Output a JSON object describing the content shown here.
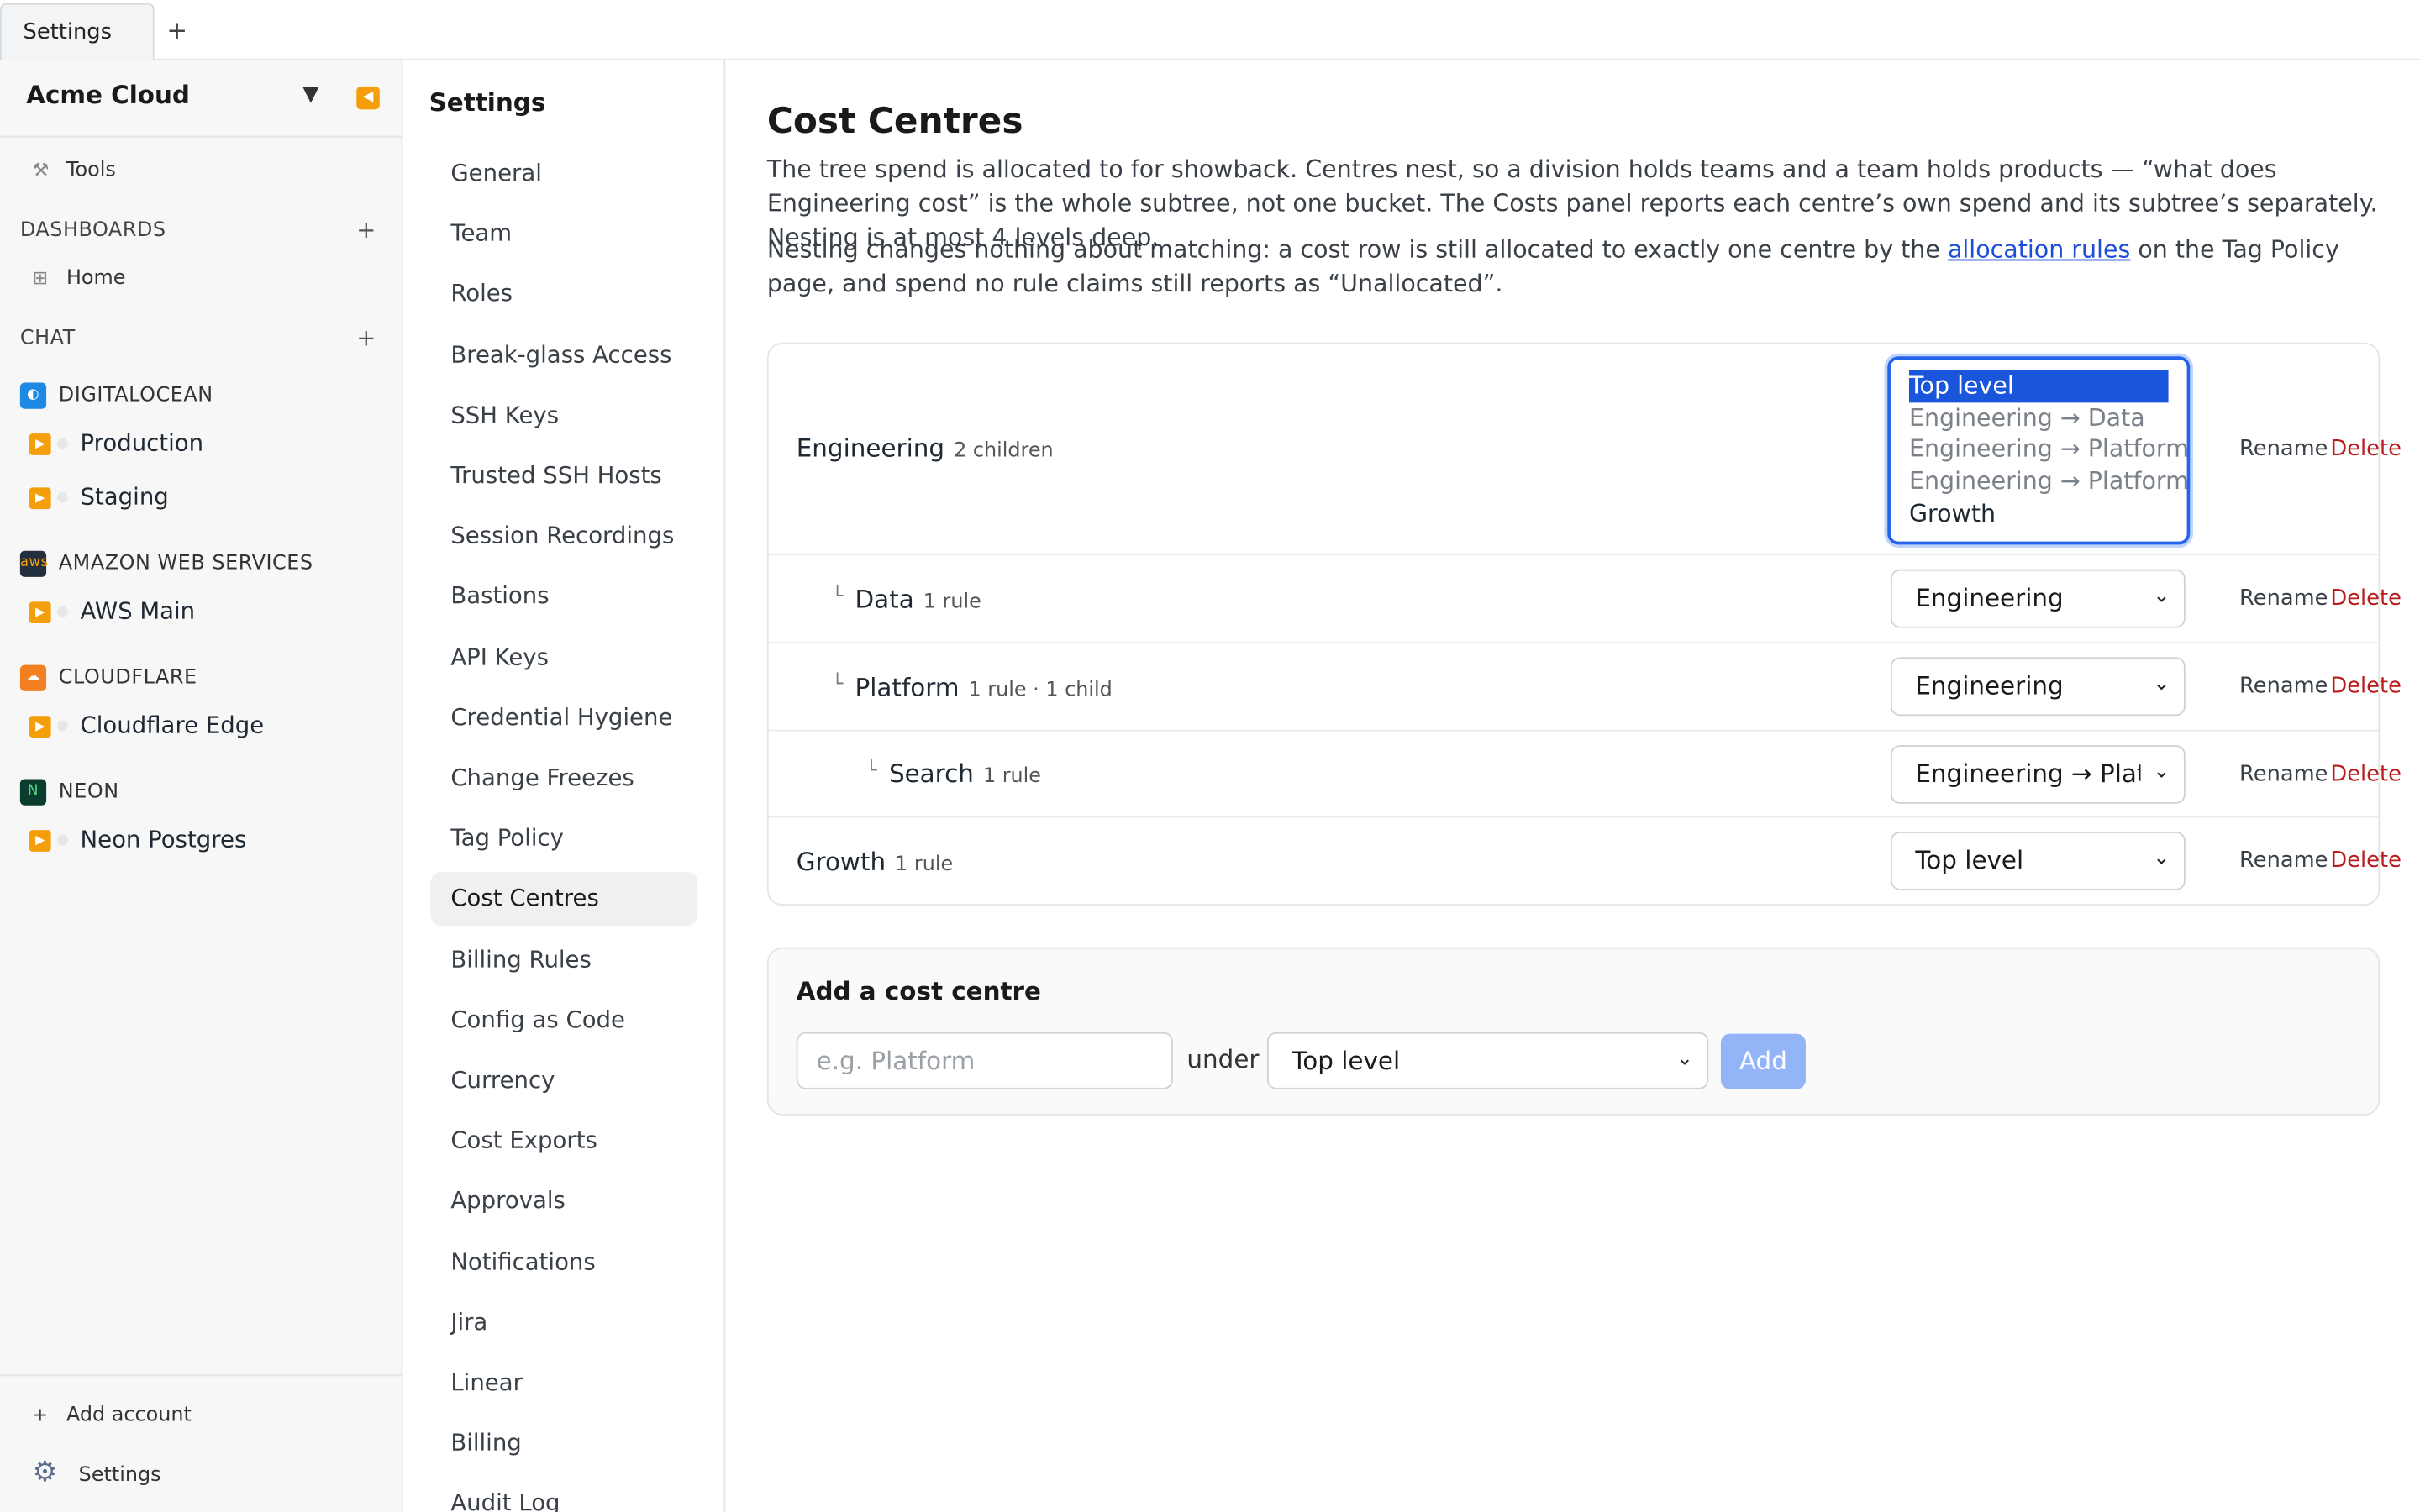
{
  "tabs": [
    {
      "label": "Settings"
    }
  ],
  "org": {
    "name": "Acme Cloud"
  },
  "sidebar": {
    "tools_label": "Tools",
    "dashboards_heading": "DASHBOARDS",
    "dashboards": [
      {
        "label": "Home"
      }
    ],
    "chat_heading": "CHAT",
    "providers": [
      {
        "name": "DIGITALOCEAN",
        "color": "#1e88e5",
        "accounts": [
          {
            "label": "Production"
          },
          {
            "label": "Staging"
          }
        ]
      },
      {
        "name": "AMAZON WEB SERVICES",
        "color": "#232f3e",
        "accounts": [
          {
            "label": "AWS Main"
          }
        ]
      },
      {
        "name": "CLOUDFLARE",
        "color": "#f38020",
        "accounts": [
          {
            "label": "Cloudflare Edge"
          }
        ]
      },
      {
        "name": "NEON",
        "color": "#0b3d2e",
        "accounts": [
          {
            "label": "Neon Postgres"
          }
        ]
      }
    ],
    "add_account_label": "Add account",
    "settings_label": "Settings"
  },
  "settings_nav": {
    "title": "Settings",
    "items": [
      {
        "label": "General"
      },
      {
        "label": "Team"
      },
      {
        "label": "Roles"
      },
      {
        "label": "Break-glass Access"
      },
      {
        "label": "SSH Keys"
      },
      {
        "label": "Trusted SSH Hosts"
      },
      {
        "label": "Session Recordings"
      },
      {
        "label": "Bastions"
      },
      {
        "label": "API Keys"
      },
      {
        "label": "Credential Hygiene"
      },
      {
        "label": "Change Freezes"
      },
      {
        "label": "Tag Policy"
      },
      {
        "label": "Cost Centres"
      },
      {
        "label": "Billing Rules"
      },
      {
        "label": "Config as Code"
      },
      {
        "label": "Currency"
      },
      {
        "label": "Cost Exports"
      },
      {
        "label": "Approvals"
      },
      {
        "label": "Notifications"
      },
      {
        "label": "Jira"
      },
      {
        "label": "Linear"
      },
      {
        "label": "Billing"
      },
      {
        "label": "Audit Log"
      }
    ],
    "active": "Cost Centres"
  },
  "page": {
    "title": "Cost Centres",
    "intro": "The tree spend is allocated to for showback. Centres nest, so a division holds teams and a team holds products — “what does Engineering cost” is the whole subtree, not one bucket. The Costs panel reports each centre’s own spend and its subtree’s separately. Nesting is at most 4 levels deep.",
    "note_before_link": "Nesting changes nothing about matching: a cost row is still allocated to exactly one centre by the ",
    "note_link": "allocation rules",
    "note_after_link": " on the Tag Policy page, and spend no rule claims still reports as “Unallocated”."
  },
  "tree": {
    "rename_label": "Rename",
    "delete_label": "Delete",
    "rows": [
      {
        "name": "Engineering",
        "meta": "2 children",
        "depth": 0,
        "parent": "Top level"
      },
      {
        "name": "Data",
        "meta": "1 rule",
        "depth": 1,
        "parent": "Engineering"
      },
      {
        "name": "Platform",
        "meta": "1 rule · 1 child",
        "depth": 1,
        "parent": "Engineering"
      },
      {
        "name": "Search",
        "meta": "1 rule",
        "depth": 2,
        "parent": "Engineering → Platform"
      },
      {
        "name": "Growth",
        "meta": "1 rule",
        "depth": 0,
        "parent": "Top level"
      }
    ],
    "open_listbox": {
      "options": [
        {
          "label": "Top level",
          "state": "selected"
        },
        {
          "label": "Engineering → Data",
          "state": "disabled"
        },
        {
          "label": "Engineering → Platform",
          "state": "disabled"
        },
        {
          "label": "Engineering → Platform → Search",
          "state": "disabled"
        },
        {
          "label": "Growth",
          "state": "enabled"
        }
      ]
    }
  },
  "add_form": {
    "title": "Add a cost centre",
    "name_placeholder": "e.g. Platform",
    "under_label": "under",
    "parent_value": "Top level",
    "add_label": "Add"
  }
}
